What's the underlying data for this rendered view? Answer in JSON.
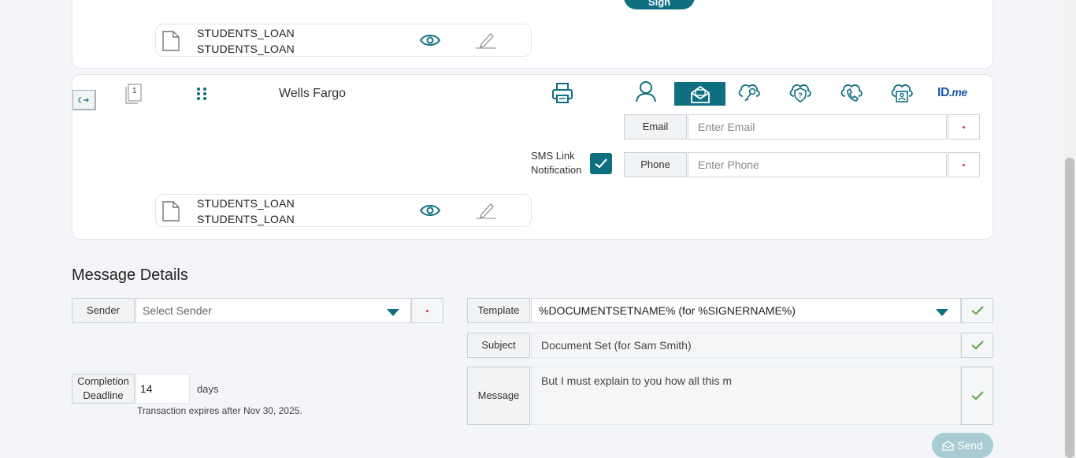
{
  "top_card": {
    "sign_button_label": "Sign",
    "document": {
      "line1": "STUDENTS_LOAN",
      "line2": "STUDENTS_LOAN"
    }
  },
  "signer_card": {
    "order_badge": "1",
    "name": "Wells Fargo",
    "auth_methods": [
      "person-icon",
      "email-auth-icon",
      "key-cloud-icon",
      "question-shield-icon",
      "phone-cloud-icon",
      "id-cloud-icon",
      "idme-icon"
    ],
    "idme_label": {
      "id": "ID",
      "me": ".me"
    },
    "email": {
      "label": "Email",
      "placeholder": "Enter Email"
    },
    "phone": {
      "label": "Phone",
      "placeholder": "Enter Phone"
    },
    "sms": {
      "label_line1": "SMS Link",
      "label_line2": "Notification",
      "checked": true
    },
    "document": {
      "line1": "STUDENTS_LOAN",
      "line2": "STUDENTS_LOAN"
    }
  },
  "message_details": {
    "title": "Message Details",
    "sender": {
      "label": "Sender",
      "placeholder": "Select Sender"
    },
    "template": {
      "label": "Template",
      "value": "%DOCUMENTSETNAME% (for %SIGNERNAME%)"
    },
    "subject": {
      "label": "Subject",
      "value": "Document Set (for Sam Smith)"
    },
    "message": {
      "label": "Message",
      "value": "But I must explain to you how all this m"
    },
    "deadline": {
      "label_line1": "Completion",
      "label_line2": "Deadline",
      "value": "14",
      "unit": "days",
      "note": "Transaction expires after Nov 30, 2025."
    },
    "send_label": "Send"
  },
  "colors": {
    "teal": "#0e6f80",
    "check_green": "#5da342",
    "send_disabled": "#a9cbd3"
  }
}
